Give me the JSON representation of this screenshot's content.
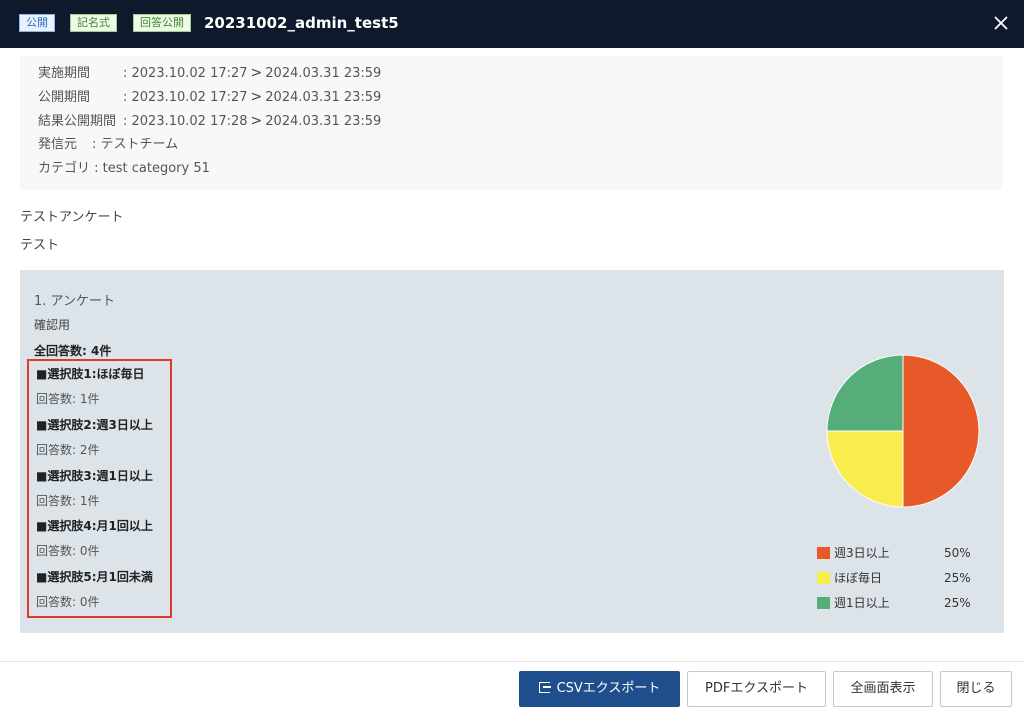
{
  "header": {
    "tags": [
      "公開",
      "記名式",
      "回答公開"
    ],
    "title": "20231002_admin_test5"
  },
  "info": {
    "period_label": "実施期間",
    "period_start": ": 2023.10.02 17:27",
    "period_end": "2024.03.31 23:59",
    "public_label": "公開期間",
    "public_start": ": 2023.10.02 17:27",
    "public_end": "2024.03.31 23:59",
    "result_label": "結果公開期間",
    "result_start": ": 2023.10.02 17:28",
    "result_end": "2024.03.31 23:59",
    "sender_label": "発信元",
    "sender_value": ": テストチーム",
    "category_label": "カテゴリ",
    "category_value": ": test category 51"
  },
  "description": {
    "line1": "テストアンケート",
    "line2": "テスト"
  },
  "question": {
    "title": "1. アンケート",
    "subtitle": "確認用",
    "total": "全回答数: 4件",
    "options": [
      {
        "label": "■選択肢1:ほぼ毎日",
        "count": "回答数: 1件"
      },
      {
        "label": "■選択肢2:週3日以上",
        "count": "回答数: 2件"
      },
      {
        "label": "■選択肢3:週1日以上",
        "count": "回答数: 1件"
      },
      {
        "label": "■選択肢4:月1回以上",
        "count": "回答数: 0件"
      },
      {
        "label": "■選択肢5:月1回未満",
        "count": "回答数: 0件"
      }
    ]
  },
  "chart_data": {
    "type": "pie",
    "slices": [
      {
        "name": "週3日以上",
        "value": 50,
        "label": "50%",
        "color": "#e8592a"
      },
      {
        "name": "ほぼ毎日",
        "value": 25,
        "label": "25%",
        "color": "#f9ec4e"
      },
      {
        "name": "週1日以上",
        "value": 25,
        "label": "25%",
        "color": "#55ad7a"
      }
    ],
    "legend_position": "bottom-right"
  },
  "footer": {
    "csv_label": "CSVエクスポート",
    "pdf_label": "PDFエクスポート",
    "fullscreen_label": "全画面表示",
    "close_label": "閉じる"
  }
}
